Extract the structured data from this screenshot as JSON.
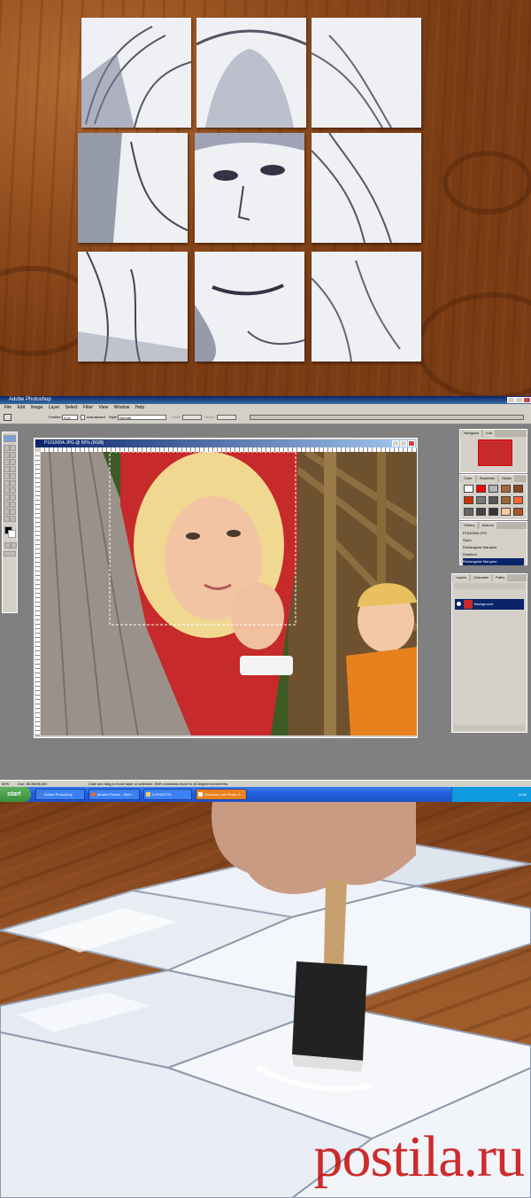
{
  "photoshop": {
    "app_title": "Adobe Photoshop",
    "menu": [
      "File",
      "Edit",
      "Image",
      "Layer",
      "Select",
      "Filter",
      "View",
      "Window",
      "Help"
    ],
    "options_bar": {
      "feather_label": "Feather:",
      "feather_value": "0 px",
      "antialiased_label": "Anti-aliased",
      "style_label": "Style:",
      "style_value": "Normal",
      "width_label": "Width:",
      "height_label": "Height:"
    },
    "document": {
      "title": "P1010004.JPG @ 50% (RGB)"
    },
    "navigator_panel": {
      "tabs": [
        "Navigator",
        "Info"
      ]
    },
    "swatches_panel": {
      "tabs": [
        "Color",
        "Swatches",
        "Styles"
      ],
      "swatch_colors": [
        "#ffffff",
        "#ff0000",
        "#b4b4b4",
        "#aa6633",
        "#884422",
        "#cc3300",
        "#777777",
        "#555555",
        "#996633",
        "#ff6633",
        "#666666",
        "#444444",
        "#333333",
        "#ffcc99",
        "#aa5522"
      ]
    },
    "history_panel": {
      "tabs": [
        "History",
        "Actions"
      ],
      "items": [
        "P1010004.JPG",
        "Open",
        "Rectangular Marquee",
        "Deselect",
        "Rectangular Marquee"
      ],
      "active_index": 4
    },
    "layers_panel": {
      "tabs": [
        "Layers",
        "Channels",
        "Paths"
      ],
      "layer": "Background"
    },
    "status": {
      "zoom": "50%",
      "doc": "Doc: 35.3M/35.3M",
      "hint": "Click and drag to move layer or selection. Shift constrains move to 45 degree increments."
    },
    "taskbar": {
      "start": "start",
      "tasks": [
        "Adobe Photoshop",
        "Mozilla Firefox - Start...",
        "Z:\\PHOTOS",
        "Windows Live Photo G..."
      ],
      "clock": "11:54"
    }
  },
  "watermark": "postila.ru",
  "colors": {
    "accent_watermark": "#c40000",
    "xp_taskbar": "#245edb",
    "xp_start": "#3b8f3b"
  }
}
